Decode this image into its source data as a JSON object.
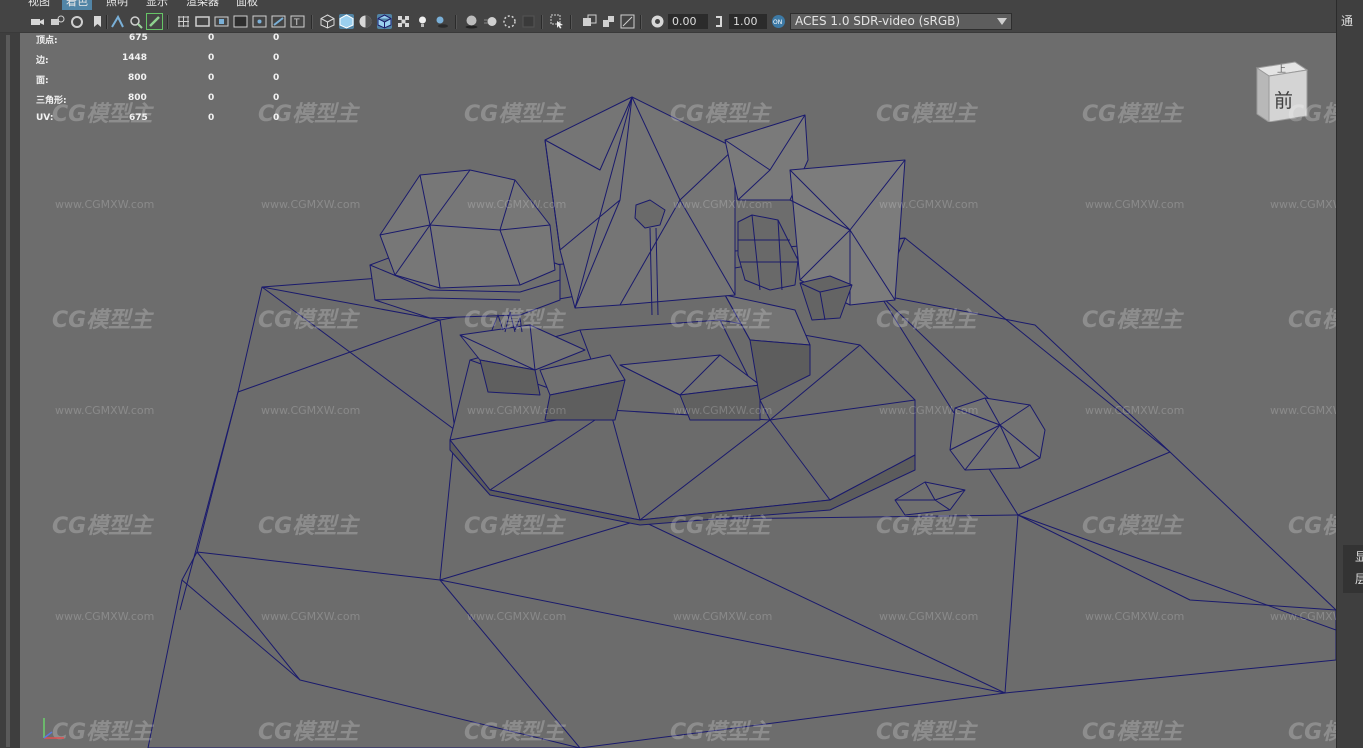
{
  "menubar": {
    "items": [
      {
        "label": "视图",
        "active": false
      },
      {
        "label": "着色",
        "active": true
      },
      {
        "label": "照明",
        "active": false
      },
      {
        "label": "显示",
        "active": false
      },
      {
        "label": "渲染器",
        "active": false
      },
      {
        "label": "面板",
        "active": false
      }
    ]
  },
  "toolbar": {
    "exposure_value": "0.00",
    "gamma_value": "1.00",
    "color_management_badge": "ON",
    "color_space": "ACES 1.0 SDR-video (sRGB)"
  },
  "hud": {
    "rows": [
      {
        "label": "顶点:",
        "a": "675",
        "b": "0",
        "c": "0"
      },
      {
        "label": "边:",
        "a": "1448",
        "b": "0",
        "c": "0"
      },
      {
        "label": "面:",
        "a": "800",
        "b": "0",
        "c": "0"
      },
      {
        "label": "三角形:",
        "a": "800",
        "b": "0",
        "c": "0"
      },
      {
        "label": "UV:",
        "a": "675",
        "b": "0",
        "c": "0"
      }
    ]
  },
  "viewcube": {
    "top_label": "上",
    "front_label": "前"
  },
  "right_panel": {
    "label_1": "通",
    "label_2": "显",
    "label_3": "层"
  },
  "watermark": {
    "logo": "CG模型主",
    "url": "www.CGMXW.com"
  },
  "colors": {
    "viewport_bg": "#6d6d6d",
    "wireframe": "#16166a",
    "active_menu": "#5285a6"
  }
}
